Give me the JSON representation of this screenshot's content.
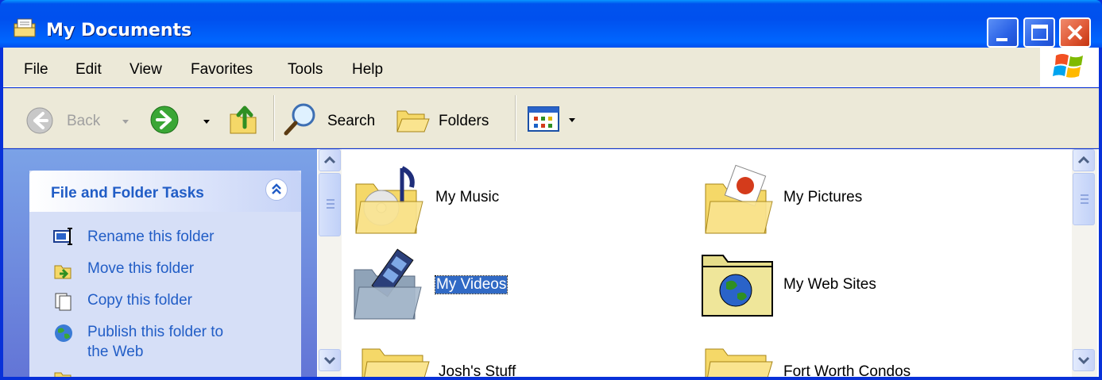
{
  "window": {
    "title": "My Documents"
  },
  "menubar": {
    "items": [
      "File",
      "Edit",
      "View",
      "Favorites",
      "Tools",
      "Help"
    ]
  },
  "toolbar": {
    "back_label": "Back",
    "search_label": "Search",
    "folders_label": "Folders"
  },
  "taskpane": {
    "title": "File and Folder Tasks",
    "tasks": [
      "Rename this folder",
      "Move this folder",
      "Copy this folder",
      "Publish this folder to",
      "the Web"
    ]
  },
  "files": [
    {
      "name": "My Music",
      "icon": "music-folder-icon"
    },
    {
      "name": "My Pictures",
      "icon": "pictures-folder-icon"
    },
    {
      "name": "My Videos",
      "icon": "videos-folder-icon",
      "selected": true
    },
    {
      "name": "My Web Sites",
      "icon": "web-sites-folder-icon"
    },
    {
      "name": "Josh's Stuff",
      "icon": "folder-icon"
    },
    {
      "name": "Fort Worth Condos",
      "icon": "folder-icon"
    }
  ],
  "colors": {
    "titlebar": "#0054e3",
    "task_link": "#215dc6",
    "selection": "#316ac5"
  }
}
